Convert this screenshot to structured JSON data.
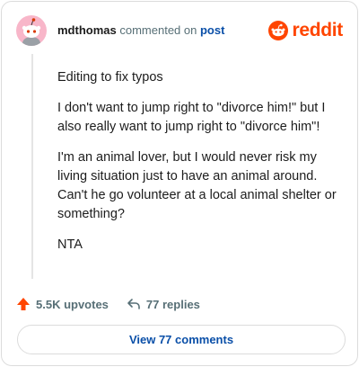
{
  "comment": {
    "username": "mdthomas",
    "action_text": "commented on",
    "target_link": "post",
    "brand": "reddit",
    "paragraphs": [
      "Editing to fix typos",
      "I don't want to jump right to \"divorce him!\" but I also really want to jump right to \"divorce him\"!",
      "I'm an animal lover, but I would never risk my living situation just to have an animal around. Can't he go volunteer at a local animal shelter or something?",
      "NTA"
    ]
  },
  "actions": {
    "upvotes": "5.5K upvotes",
    "replies": "77 replies"
  },
  "footer": {
    "view_label": "View 77 comments"
  },
  "colors": {
    "brand": "#ff4500",
    "link": "#0a4fa8",
    "avatar_bg": "#f8b6c9",
    "upvote": "#ff4500"
  }
}
